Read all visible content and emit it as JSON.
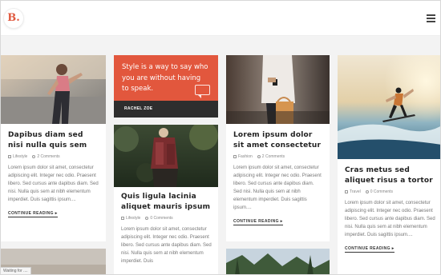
{
  "brand": {
    "logo": "B."
  },
  "header": {
    "menu_icon": "hamburger-menu-icon"
  },
  "posts": [
    {
      "title": "Dapibus diam sed nisi nulla quis sem",
      "category": "Lifestyle",
      "comments": "2 Comments",
      "excerpt": "Lorem ipsum dolor sit amet, consectetur adipiscing elit. Integer nec odio. Praesent libero. Sed cursus ante dapibus diam. Sed nisi. Nulla quis sem at nibh elementum imperdiet. Duis sagittis ipsum....",
      "more": "CONTINUE READING"
    },
    {
      "title": "Quis ligula lacinia aliquet mauris ipsum",
      "category": "Lifestyle",
      "comments": "0 Comments",
      "excerpt": "Lorem ipsum dolor sit amet, consectetur adipiscing elit. Integer nec odio. Praesent libero. Sed cursus ante dapibus diam. Sed nisi. Nulla quis sem at nibh elementum imperdiet. Duis"
    },
    {
      "title": "Lorem ipsum dolor sit amet consectetur",
      "category": "Fashion",
      "comments": "2 Comments",
      "excerpt": "Lorem ipsum dolor sit amet, consectetur adipiscing elit. Integer nec odio. Praesent libero. Sed cursus ante dapibus diam. Sed nisi. Nulla quis sem at nibh elementum imperdiet. Duis sagittis ipsum....",
      "more": "CONTINUE READING"
    },
    {
      "title": "Cras metus sed aliquet risus a tortor",
      "category": "Travel",
      "comments": "0 Comments",
      "excerpt": "Lorem ipsum dolor sit amet, consectetur adipiscing elit. Integer nec odio. Praesent libero. Sed cursus ante dapibus diam. Sed nisi. Nulla quis sem at nibh elementum imperdiet. Duis sagittis ipsum....",
      "more": "CONTINUE READING"
    }
  ],
  "quote": {
    "text": "Style is a way to say who you are without having to speak.",
    "author": "RACHEL ZOE"
  },
  "status": "Waiting for ...."
}
